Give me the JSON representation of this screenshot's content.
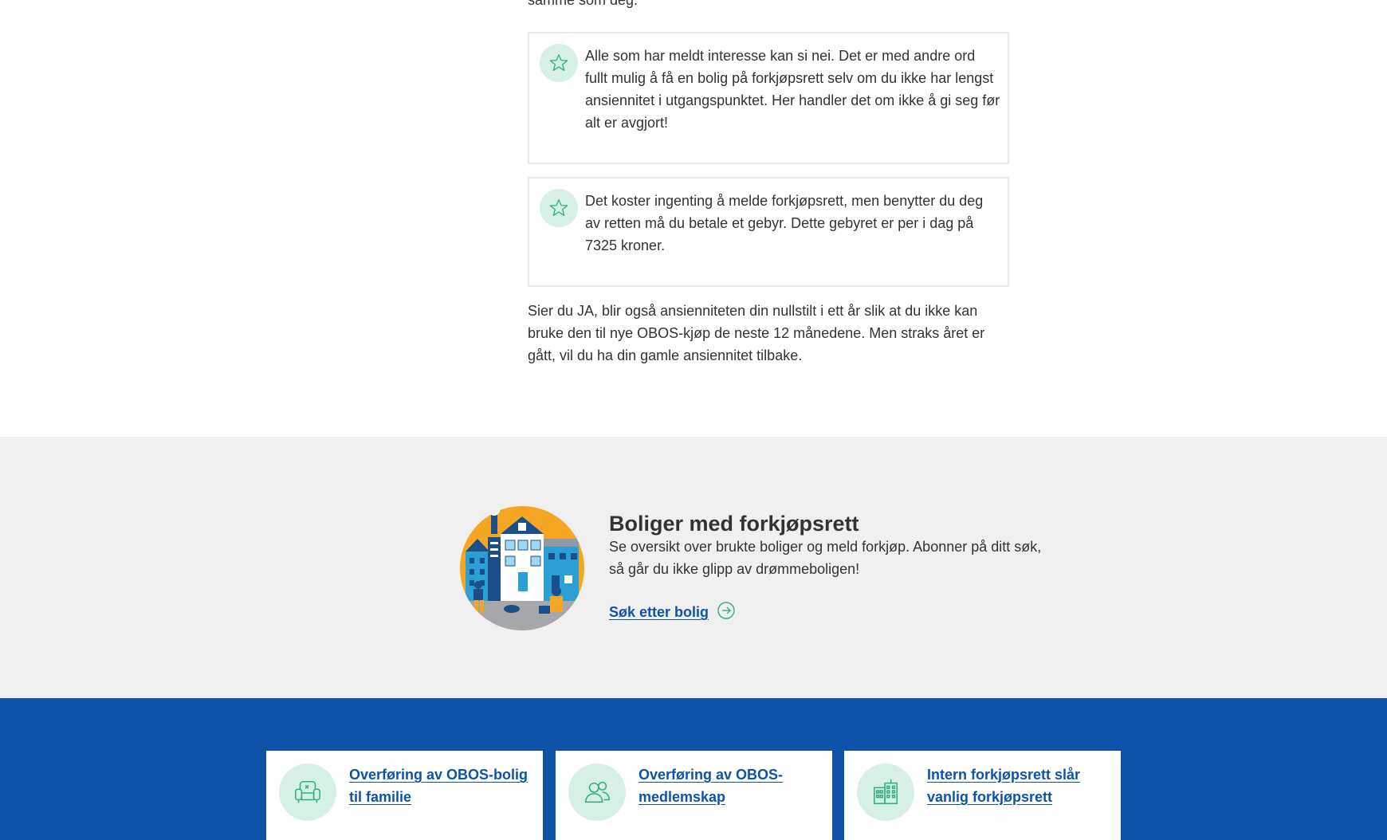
{
  "article": {
    "clipped_text": "samme som deg.",
    "tips": [
      {
        "icon": "star-icon",
        "text": "Alle som har meldt interesse kan si nei. Det er med andre ord fullt mulig å få en bolig på forkjøpsrett selv om du ikke har lengst ansiennitet i utgangspunktet. Her handler det om ikke å gi seg før alt er avgjort!"
      },
      {
        "icon": "star-icon",
        "text": "Det koster ingenting å melde forkjøpsrett, men benytter du deg av retten må du betale et gebyr. Dette gebyret er per i dag på 7325 kroner."
      }
    ],
    "paragraph": "Sier du JA, blir også ansienniteten din nullstilt i ett år slik at du ikke kan bruke den til nye OBOS-kjøp de neste 12 månedene. Men straks året er gått, vil du ha din gamle ansiennitet tilbake."
  },
  "promo": {
    "title": "Boliger med forkjøpsrett",
    "text": "Se oversikt over brukte boliger og meld forkjøp. Abonner på ditt søk, så går du ikke glipp av drømmeboligen!",
    "link_label": "Søk etter bolig",
    "link_icon": "arrow-right-circle-icon"
  },
  "related": {
    "cards": [
      {
        "icon": "armchair-icon",
        "label": "Overføring av OBOS-bolig til familie"
      },
      {
        "icon": "users-icon",
        "label": "Overføring av OBOS-medlemskap"
      },
      {
        "icon": "building-icon",
        "label": "Intern forkjøpsrett slår vanlig forkjøpsrett"
      }
    ]
  },
  "colors": {
    "brand_blue": "#0f52aa",
    "mint": "#d6f0e6",
    "green_icon": "#2fae7e",
    "promo_bg": "#f0f0f0"
  }
}
